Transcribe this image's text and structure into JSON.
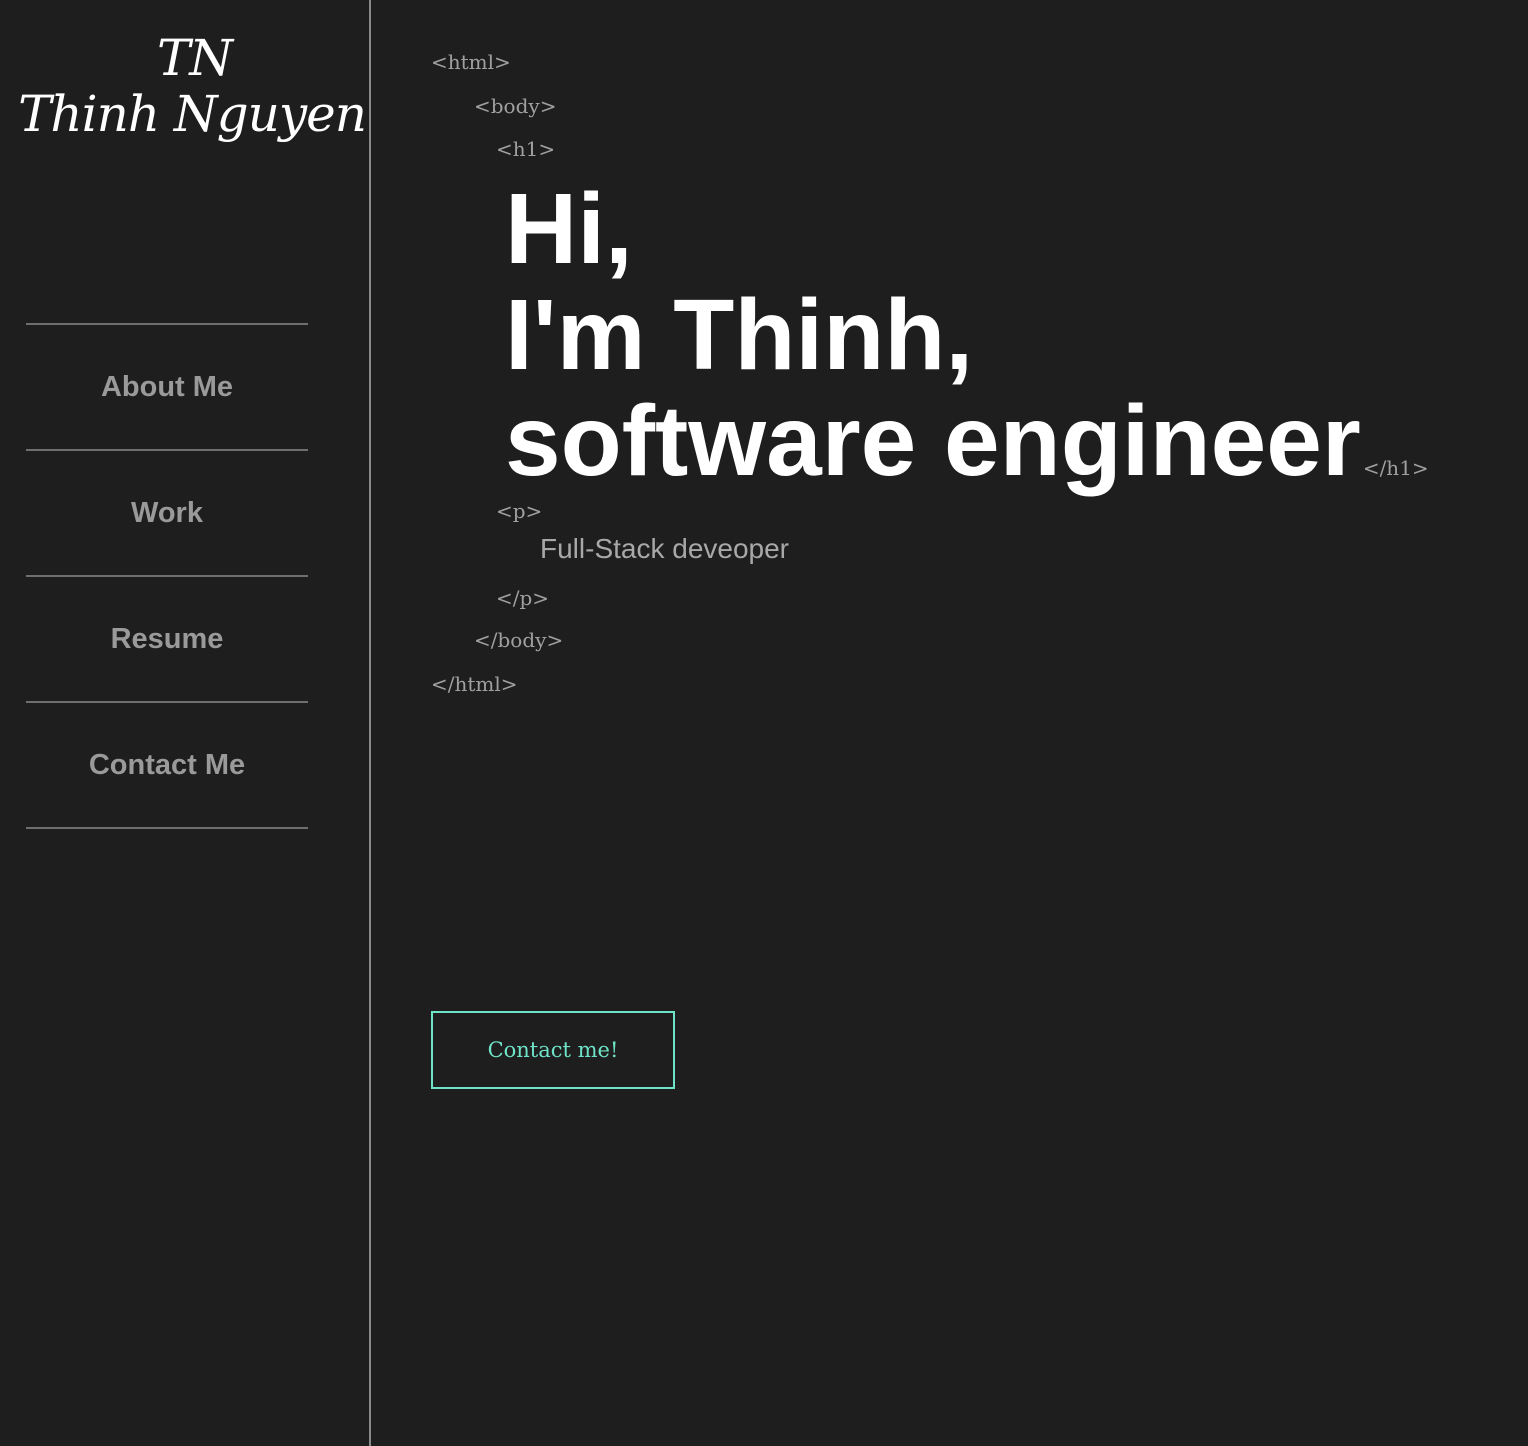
{
  "sidebar": {
    "logo": {
      "initials": "TN",
      "name": "Thinh Nguyen"
    },
    "nav": [
      {
        "label": "About Me"
      },
      {
        "label": "Work"
      },
      {
        "label": "Resume"
      },
      {
        "label": "Contact Me"
      }
    ]
  },
  "main": {
    "tags": {
      "html_open": "<html>",
      "body_open": "<body>",
      "h1_open": "<h1>",
      "h1_close": "</h1>",
      "p_open": "<p>",
      "p_close": "</p>",
      "body_close": "</body>",
      "html_close": "</html>"
    },
    "headline": {
      "line1": "Hi,",
      "line2": "I'm Thinh,",
      "line3": "software engineer"
    },
    "subtitle": "Full-Stack deveoper",
    "contact_button": "Contact me!"
  },
  "colors": {
    "background": "#1e1e1e",
    "accent": "#6fe3c7",
    "headline": "#ffffff",
    "muted": "#9a9a9a"
  }
}
